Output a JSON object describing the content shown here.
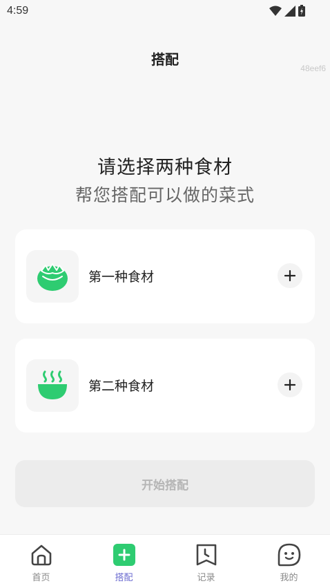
{
  "status_bar": {
    "time": "4:59",
    "icons": [
      "wifi-icon",
      "signal-icon",
      "battery-icon"
    ]
  },
  "header": {
    "title": "搭配",
    "watermark": "48eef6"
  },
  "hero": {
    "title": "请选择两种食材",
    "subtitle": "帮您搭配可以做的菜式"
  },
  "ingredients": [
    {
      "label": "第一种食材",
      "icon": "tomato-icon",
      "action_icon": "plus-icon"
    },
    {
      "label": "第二种食材",
      "icon": "bowl-icon",
      "action_icon": "plus-icon"
    }
  ],
  "start_button": {
    "label": "开始搭配",
    "enabled": false
  },
  "tabbar": {
    "active_index": 1,
    "tabs": [
      {
        "label": "首页",
        "icon": "home-icon"
      },
      {
        "label": "搭配",
        "icon": "add-square-icon"
      },
      {
        "label": "记录",
        "icon": "record-icon"
      },
      {
        "label": "我的",
        "icon": "profile-icon"
      }
    ]
  },
  "colors": {
    "accent_green": "#2ecc71",
    "active_tab": "#6b6bd0",
    "background": "#f7f7f7",
    "disabled_button": "#ececec"
  }
}
